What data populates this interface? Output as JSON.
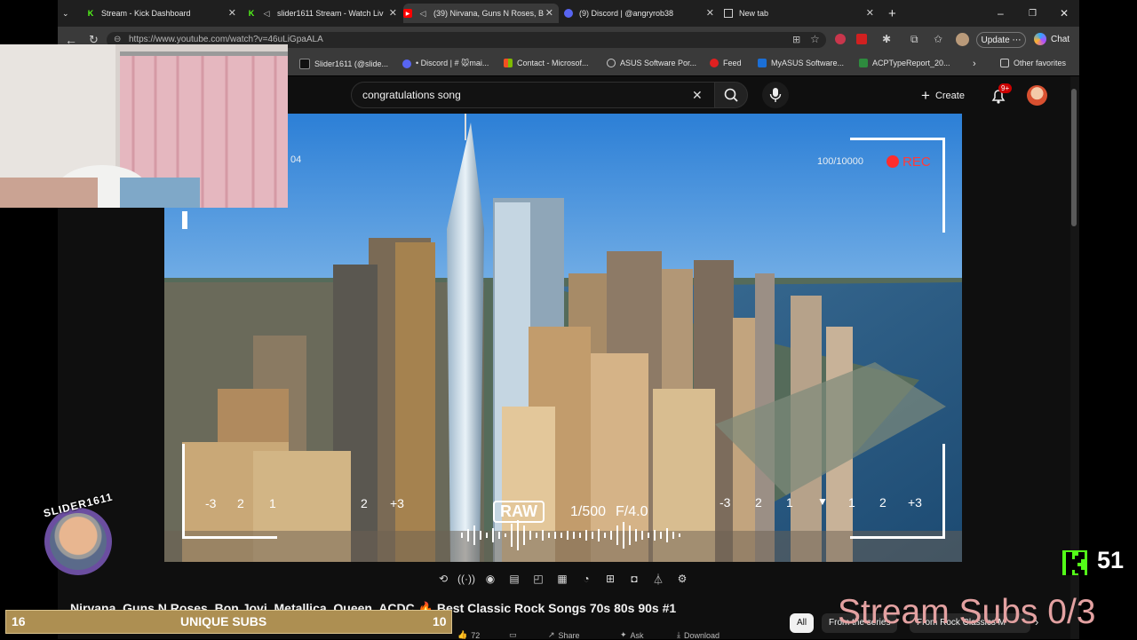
{
  "browser": {
    "tabs": [
      {
        "title": "Stream - Kick Dashboard",
        "icon": "kick-icon"
      },
      {
        "title": "slider1611 Stream - Watch Liv",
        "icon": "kick-icon"
      },
      {
        "title": "(39) Nirvana, Guns N Roses, B",
        "icon": "youtube-icon",
        "active": true
      },
      {
        "title": "(9) Discord | @angryrob38",
        "icon": "discord-icon"
      },
      {
        "title": "New tab",
        "icon": "newtab-icon"
      }
    ],
    "url": "https://www.youtube.com/watch?v=46uLiGpaALA",
    "update_label": "Update",
    "chat_label": "Chat",
    "favorites": [
      {
        "label": "Slider1611 (@slide...",
        "color": "#111111"
      },
      {
        "label": "• Discord | # 🐭mai...",
        "color": "#5865f2"
      },
      {
        "label": "Contact - Microsof...",
        "color": "#f25022"
      },
      {
        "label": "ASUS Software Por...",
        "color": "#777777"
      },
      {
        "label": "Feed",
        "color": "#e02020"
      },
      {
        "label": "MyASUS Software...",
        "color": "#1b6fd6"
      },
      {
        "label": "ACPTypeReport_20...",
        "color": "#2e8b3e"
      }
    ],
    "other_favorites": "Other favorites"
  },
  "youtube": {
    "search_value": "congratulations song",
    "create_label": "Create",
    "notif_badge": "9+",
    "video_title": "Nirvana, Guns N Roses, Bon Jovi, Metallica, Queen, ACDC 🔥 Best Classic Rock Songs 70s 80s 90s #1",
    "chips": [
      "All",
      "From the series",
      "From Rock Classics M"
    ],
    "actions": {
      "likes": "72",
      "share": "Share",
      "ask": "Ask",
      "download": "Download"
    }
  },
  "video_overlay": {
    "counter": "100/10000",
    "rec": "REC",
    "left_tag": "04",
    "raw": "RAW",
    "shutter": "1/500",
    "aperture": "F/4.0",
    "scale_left": [
      "-3",
      "2",
      "1",
      "",
      "",
      "2",
      "+3"
    ],
    "scale_right": [
      "-3",
      "2",
      "1",
      "",
      "1",
      "2",
      "+3"
    ]
  },
  "stream_overlay": {
    "streamer_name": "SLIDER1611",
    "unique_subs_label": "UNIQUE SUBS",
    "unique_left": "16",
    "unique_right": "10",
    "stream_subs": "Stream Subs 0/3",
    "kick_count": "51"
  },
  "colors": {
    "accent_red": "#ff2d2d",
    "kick_green": "#53fc18",
    "subs_pink": "#e3a1a1",
    "chrome_dark": "#1f1f1f"
  }
}
